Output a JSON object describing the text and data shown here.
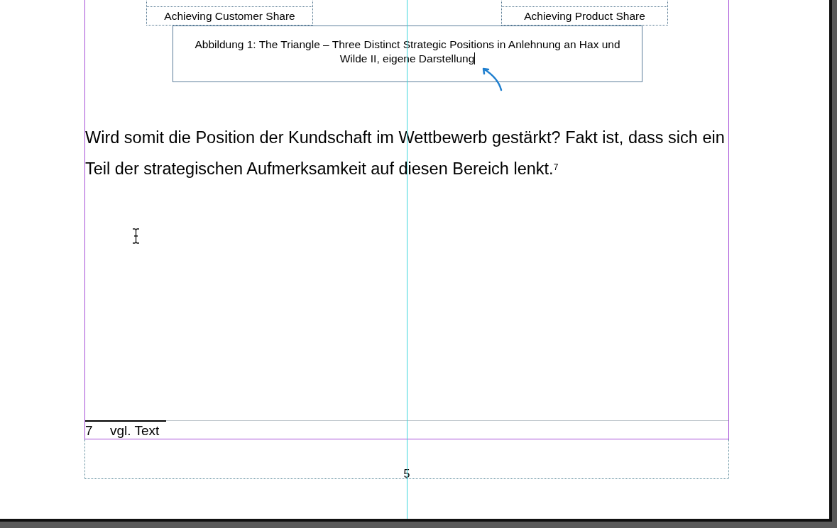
{
  "diagram_boxes": [
    {
      "subtitle": "Achieving Customer Share"
    },
    {
      "subtitle": "Achieving Product Share"
    }
  ],
  "caption": "Abbildung 1: The Triangle – Three Distinct Strategic Positions in Anlehnung an Hax und Wilde II, eigene Darstellung",
  "body": "Wird somit die Position der Kundschaft im Wettbewerb gestärkt? Fakt ist, dass sich ein Teil der strategischen Aufmerksamkeit auf diesen Bereich lenkt.$^{7}$",
  "footnote": {
    "number": "7",
    "text": "vgl. Text"
  },
  "page_number": "5"
}
